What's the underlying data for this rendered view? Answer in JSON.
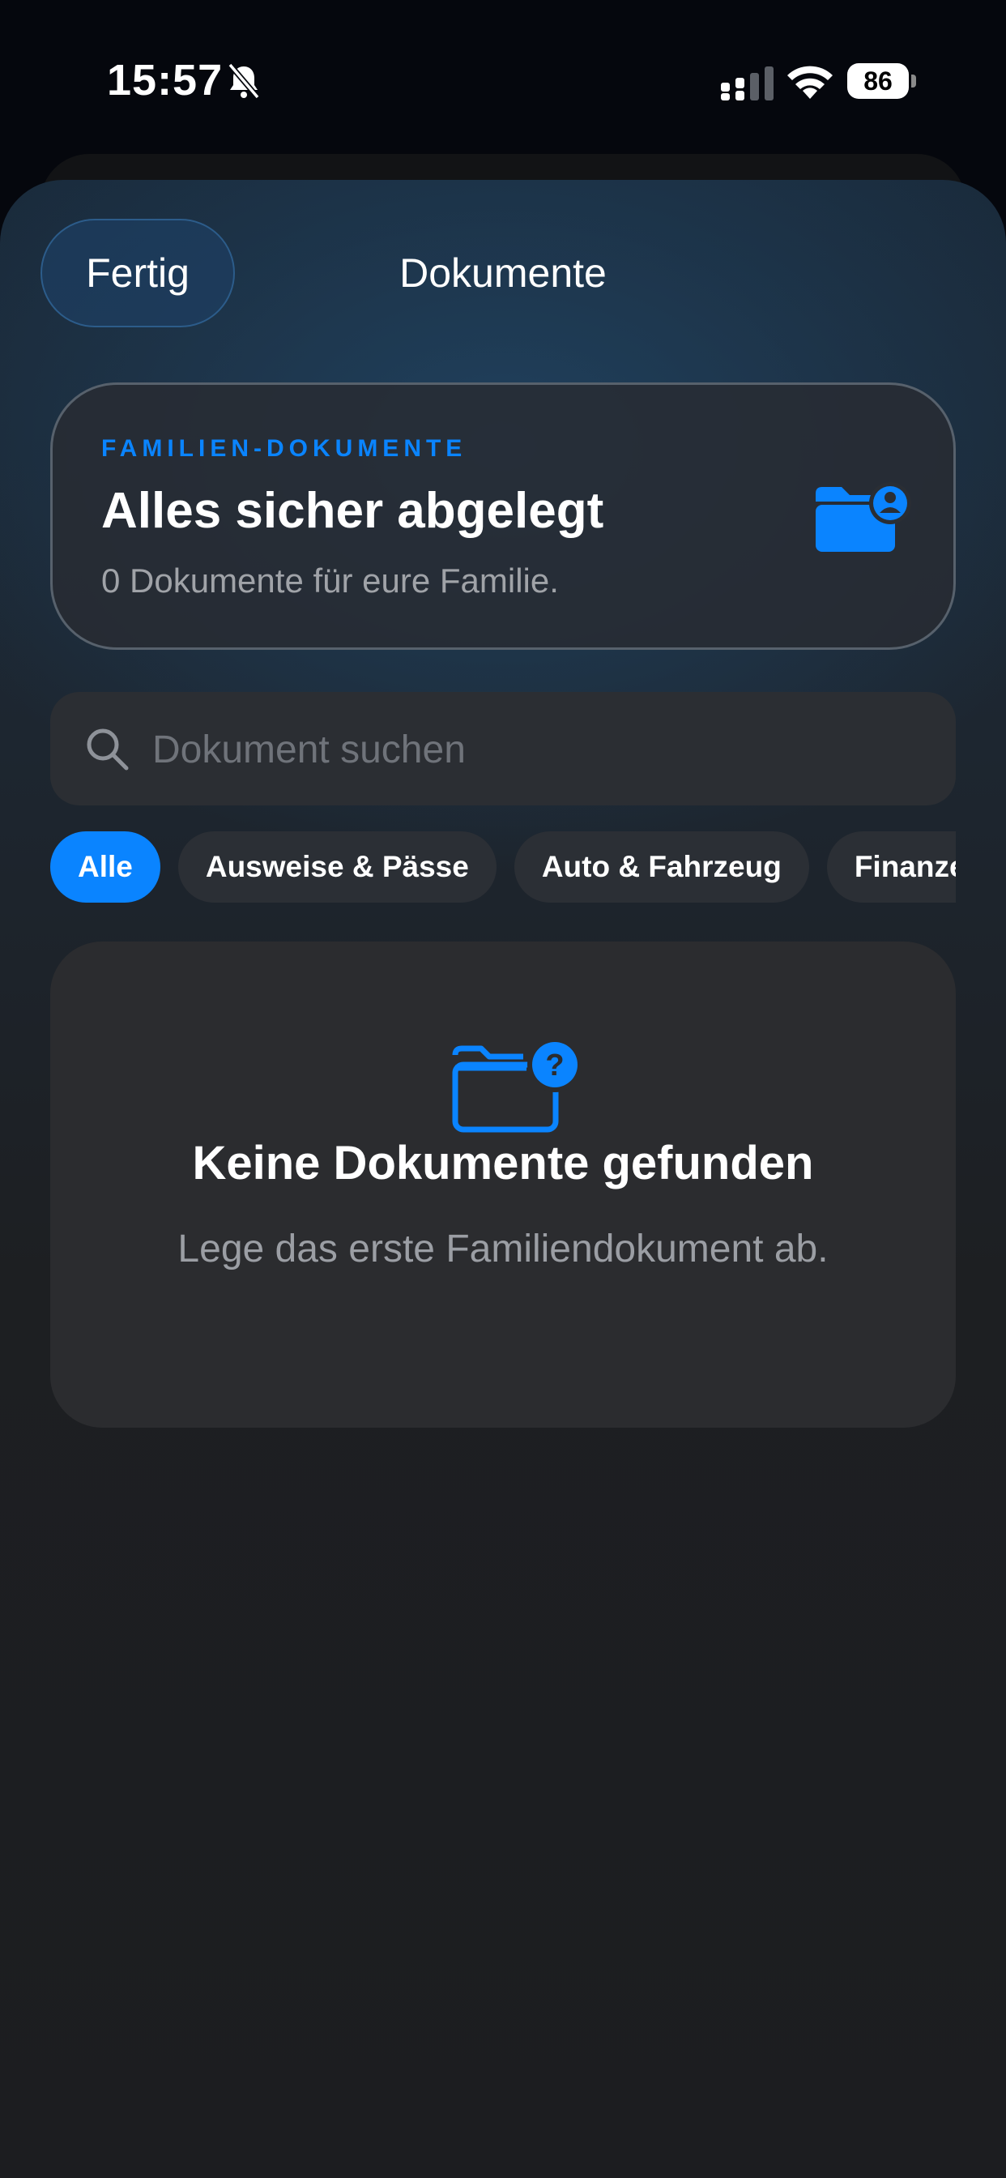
{
  "status_bar": {
    "time": "15:57",
    "battery": "86"
  },
  "header": {
    "done_label": "Fertig",
    "title": "Dokumente"
  },
  "hero": {
    "kicker": "FAMILIEN-DOKUMENTE",
    "title": "Alles sicher abgelegt",
    "subtitle": "0 Dokumente für eure Familie."
  },
  "search": {
    "placeholder": "Dokument suchen",
    "value": ""
  },
  "filters": [
    {
      "label": "Alle",
      "selected": true
    },
    {
      "label": "Ausweise & Pässe",
      "selected": false
    },
    {
      "label": "Auto & Fahrzeug",
      "selected": false
    },
    {
      "label": "Finanzen",
      "selected": false
    }
  ],
  "empty_state": {
    "title": "Keine Dokumente gefunden",
    "subtitle": "Lege das erste Familiendokument ab."
  },
  "colors": {
    "accent": "#0a84ff",
    "background": "#1d1f22",
    "card": "#2b2c2f"
  }
}
